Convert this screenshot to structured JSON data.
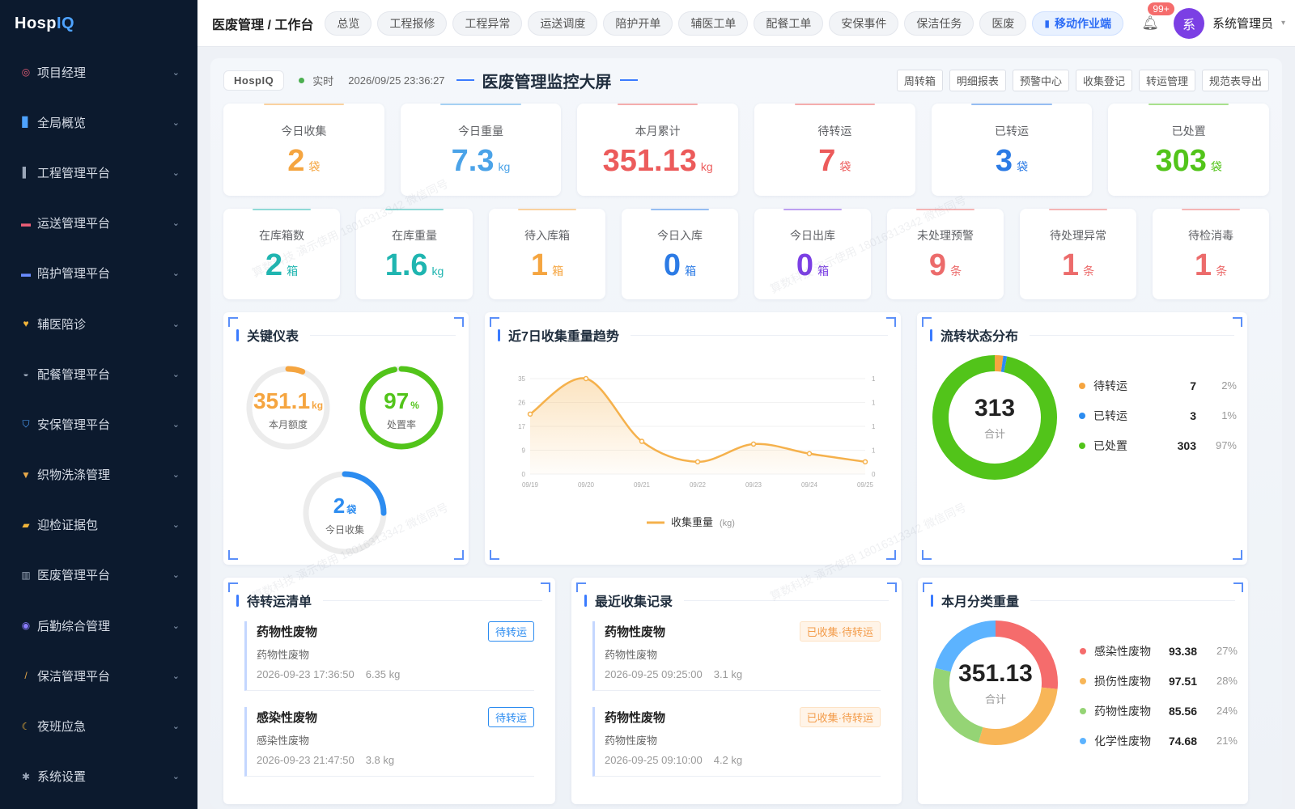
{
  "app": {
    "logo_main": "Hosp",
    "logo_accent": "IQ"
  },
  "sidebar": {
    "items": [
      {
        "label": "项目经理",
        "icon": "target-icon",
        "glyph": "◎",
        "color": "#e85d75"
      },
      {
        "label": "全局概览",
        "icon": "chart-icon",
        "glyph": "▊",
        "color": "#4ea3ff"
      },
      {
        "label": "工程管理平台",
        "icon": "building-icon",
        "glyph": "▌",
        "color": "#9aa6b8"
      },
      {
        "label": "运送管理平台",
        "icon": "truck-icon",
        "glyph": "▬",
        "color": "#e85d75"
      },
      {
        "label": "陪护管理平台",
        "icon": "bed-icon",
        "glyph": "▬",
        "color": "#6a8cff"
      },
      {
        "label": "辅医陪诊",
        "icon": "heart-icon",
        "glyph": "♥",
        "color": "#f2b53a"
      },
      {
        "label": "配餐管理平台",
        "icon": "bowl-icon",
        "glyph": "◒",
        "color": "#9aa6b8"
      },
      {
        "label": "安保管理平台",
        "icon": "shield-icon",
        "glyph": "⛉",
        "color": "#4ea3ff"
      },
      {
        "label": "织物洗涤管理",
        "icon": "basket-icon",
        "glyph": "▼",
        "color": "#e8a94a"
      },
      {
        "label": "迎检证据包",
        "icon": "folder-icon",
        "glyph": "▰",
        "color": "#f2b53a"
      },
      {
        "label": "医废管理平台",
        "icon": "trash-icon",
        "glyph": "▥",
        "color": "#9aa6b8"
      },
      {
        "label": "后勤综合管理",
        "icon": "people-icon",
        "glyph": "◉",
        "color": "#8a7cff"
      },
      {
        "label": "保洁管理平台",
        "icon": "broom-icon",
        "glyph": "/",
        "color": "#e8a94a"
      },
      {
        "label": "夜班应急",
        "icon": "moon-icon",
        "glyph": "☾",
        "color": "#f2b53a"
      },
      {
        "label": "系统设置",
        "icon": "gear-icon",
        "glyph": "✱",
        "color": "#9aa6b8"
      }
    ]
  },
  "topbar": {
    "breadcrumb": "医废管理 / 工作台",
    "tabs": [
      "总览",
      "工程报修",
      "工程异常",
      "运送调度",
      "陪护开单",
      "辅医工单",
      "配餐工单",
      "安保事件",
      "保洁任务",
      "医废"
    ],
    "active_tab": "移动作业端",
    "badge": "99+",
    "avatar": "系",
    "user": "系统管理员"
  },
  "board": {
    "brand": "HospIQ",
    "live": "实时",
    "time": "2026/09/25 23:36:27",
    "title": "医废管理监控大屏",
    "quick": [
      "周转箱",
      "明细报表",
      "预警中心",
      "收集登记",
      "转运管理",
      "规范表导出"
    ]
  },
  "stats_row1": [
    {
      "label": "今日收集",
      "value": "2",
      "unit": "袋",
      "color": "#f5a540"
    },
    {
      "label": "今日重量",
      "value": "7.3",
      "unit": "kg",
      "color": "#4ba3e8"
    },
    {
      "label": "本月累计",
      "value": "351.13",
      "unit": "kg",
      "color": "#ec5b5b"
    },
    {
      "label": "待转运",
      "value": "7",
      "unit": "袋",
      "color": "#ec5b5b"
    },
    {
      "label": "已转运",
      "value": "3",
      "unit": "袋",
      "color": "#2c7be5"
    },
    {
      "label": "已处置",
      "value": "303",
      "unit": "袋",
      "color": "#52c41a"
    }
  ],
  "stats_row2": [
    {
      "label": "在库箱数",
      "value": "2",
      "unit": "箱",
      "color": "#1fb5b0"
    },
    {
      "label": "在库重量",
      "value": "1.6",
      "unit": "kg",
      "color": "#1fb5b0"
    },
    {
      "label": "待入库箱",
      "value": "1",
      "unit": "箱",
      "color": "#f5a540"
    },
    {
      "label": "今日入库",
      "value": "0",
      "unit": "箱",
      "color": "#2c7be5"
    },
    {
      "label": "今日出库",
      "value": "0",
      "unit": "箱",
      "color": "#7b3fe4"
    },
    {
      "label": "未处理预警",
      "value": "9",
      "unit": "条",
      "color": "#ec6b6b"
    },
    {
      "label": "待处理异常",
      "value": "1",
      "unit": "条",
      "color": "#ec6b6b"
    },
    {
      "label": "待检消毒",
      "value": "1",
      "unit": "条",
      "color": "#ec6b6b"
    }
  ],
  "gauges": {
    "title": "关键仪表",
    "items": [
      {
        "value": "351.1",
        "unit": "kg",
        "label": "本月额度",
        "fraction": 0.06,
        "color": "#f5a540"
      },
      {
        "value": "97",
        "unit": "%",
        "label": "处置率",
        "fraction": 0.97,
        "color": "#52c41a"
      },
      {
        "value": "2",
        "unit": "袋",
        "label": "今日收集",
        "fraction": 0.25,
        "color": "#2c8cf0"
      }
    ]
  },
  "chart_data": {
    "type": "area",
    "title": "近7日收集重量趋势",
    "x": [
      "09/19",
      "09/20",
      "09/21",
      "09/22",
      "09/23",
      "09/24",
      "09/25"
    ],
    "series": [
      {
        "name": "收集重量",
        "unit": "(kg)",
        "values": [
          22,
          35,
          12,
          4.5,
          11,
          7.5,
          4.5
        ]
      }
    ],
    "y_left_ticks": [
      "0",
      "9",
      "17",
      "26",
      "35"
    ],
    "y_right_ticks": [
      "0",
      "1",
      "1",
      "1",
      "1"
    ],
    "ylim": [
      0,
      35
    ],
    "color": "#f5b14c"
  },
  "flow": {
    "title": "流转状态分布",
    "total": "313",
    "total_label": "合计",
    "items": [
      {
        "name": "待转运",
        "value": "7",
        "pct": "2%",
        "color": "#f5a540",
        "share": 0.022
      },
      {
        "name": "已转运",
        "value": "3",
        "pct": "1%",
        "color": "#2c8cf0",
        "share": 0.01
      },
      {
        "name": "已处置",
        "value": "303",
        "pct": "97%",
        "color": "#52c41a",
        "share": 0.968
      }
    ]
  },
  "pending": {
    "title": "待转运清单",
    "items": [
      {
        "title": "药物性废物",
        "sub": "药物性废物",
        "time": "2026-09-23 17:36:50",
        "weight": "6.35 kg",
        "tag": "待转运"
      },
      {
        "title": "感染性废物",
        "sub": "感染性废物",
        "time": "2026-09-23 21:47:50",
        "weight": "3.8 kg",
        "tag": "待转运"
      }
    ]
  },
  "recent": {
    "title": "最近收集记录",
    "items": [
      {
        "title": "药物性废物",
        "sub": "药物性废物",
        "time": "2026-09-25 09:25:00",
        "weight": "3.1 kg",
        "tag": "已收集·待转运"
      },
      {
        "title": "药物性废物",
        "sub": "药物性废物",
        "time": "2026-09-25 09:10:00",
        "weight": "4.2 kg",
        "tag": "已收集·待转运"
      }
    ]
  },
  "category": {
    "title": "本月分类重量",
    "total": "351.13",
    "total_label": "合计",
    "items": [
      {
        "name": "感染性废物",
        "value": "93.38",
        "pct": "27%",
        "color": "#f56c6c",
        "share": 0.266
      },
      {
        "name": "损伤性废物",
        "value": "97.51",
        "pct": "28%",
        "color": "#f8b658",
        "share": 0.278
      },
      {
        "name": "药物性废物",
        "value": "85.56",
        "pct": "24%",
        "color": "#95d475",
        "share": 0.244
      },
      {
        "name": "化学性废物",
        "value": "74.68",
        "pct": "21%",
        "color": "#5cb3ff",
        "share": 0.212
      }
    ]
  },
  "watermark": "算数科技 演示使用 18016313342 微信同号"
}
